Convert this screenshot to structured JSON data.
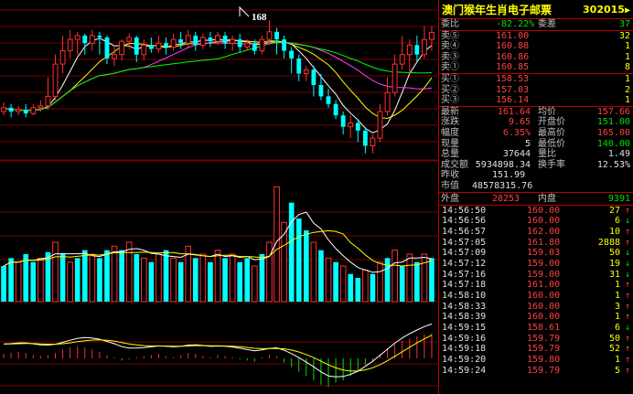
{
  "stock": {
    "name": "澳门猴年生肖电子邮票",
    "code": "302015"
  },
  "annotation": "168",
  "ratio": {
    "label": "委比",
    "value": "-82.22%",
    "diff_label": "委差",
    "diff_value": "37"
  },
  "sells": [
    {
      "label": "卖⑤",
      "price": "161.00",
      "vol": "32"
    },
    {
      "label": "卖④",
      "price": "160.88",
      "vol": "1"
    },
    {
      "label": "卖③",
      "price": "160.86",
      "vol": "1"
    },
    {
      "label": "卖①",
      "price": "160.85",
      "vol": "8"
    }
  ],
  "buys": [
    {
      "label": "买①",
      "price": "158.53",
      "vol": "1"
    },
    {
      "label": "买②",
      "price": "157.03",
      "vol": "2"
    },
    {
      "label": "买③",
      "price": "156.14",
      "vol": "1"
    }
  ],
  "stats": [
    {
      "l1": "最新",
      "v1": "161.64",
      "c1": "red",
      "l2": "均价",
      "v2": "157.66",
      "c2": "red"
    },
    {
      "l1": "涨跌",
      "v1": "9.65",
      "c1": "red",
      "l2": "开盘价",
      "v2": "151.00",
      "c2": "grn"
    },
    {
      "l1": "幅度",
      "v1": "6.35%",
      "c1": "red",
      "l2": "最高价",
      "v2": "165.00",
      "c2": "red"
    },
    {
      "l1": "现量",
      "v1": "5",
      "c1": "wht",
      "l2": "最低价",
      "v2": "140.00",
      "c2": "grn"
    },
    {
      "l1": "总量",
      "v1": "37644",
      "c1": "wht",
      "l2": "量比",
      "v2": "1.49",
      "c2": "wht"
    },
    {
      "l1": "成交额",
      "v1": "5934898.34",
      "c1": "wht",
      "l2": "换手率",
      "v2": "12.53%",
      "c2": "wht"
    }
  ],
  "prev_close": {
    "label": "昨收",
    "value": "151.99"
  },
  "market_cap": {
    "label": "市值",
    "value": "48578315.76"
  },
  "outer_inner": {
    "outer_label": "外盘",
    "outer_value": "28253",
    "inner_label": "内盘",
    "inner_value": "9391"
  },
  "ticks": [
    {
      "time": "14:56:50",
      "price": "160.00",
      "vol": "27",
      "dir": "up"
    },
    {
      "time": "14:56:56",
      "price": "160.00",
      "vol": "6",
      "dir": "down"
    },
    {
      "time": "14:56:57",
      "price": "162.00",
      "vol": "10",
      "dir": "up"
    },
    {
      "time": "14:57:05",
      "price": "161.80",
      "vol": "2888",
      "dir": "up"
    },
    {
      "time": "14:57:09",
      "price": "159.03",
      "vol": "50",
      "dir": "down"
    },
    {
      "time": "14:57:12",
      "price": "159.00",
      "vol": "19",
      "dir": "down"
    },
    {
      "time": "14:57:16",
      "price": "159.00",
      "vol": "31",
      "dir": "down"
    },
    {
      "time": "14:57:18",
      "price": "161.00",
      "vol": "1",
      "dir": "up"
    },
    {
      "time": "14:58:10",
      "price": "160.00",
      "vol": "1",
      "dir": "up"
    },
    {
      "time": "14:58:33",
      "price": "160.00",
      "vol": "3",
      "dir": "up"
    },
    {
      "time": "14:58:39",
      "price": "160.00",
      "vol": "1",
      "dir": "up"
    },
    {
      "time": "14:59:15",
      "price": "158.61",
      "vol": "6",
      "dir": "down"
    },
    {
      "time": "14:59:16",
      "price": "159.79",
      "vol": "50",
      "dir": "up"
    },
    {
      "time": "14:59:18",
      "price": "159.79",
      "vol": "52",
      "dir": "up"
    },
    {
      "time": "14:59:20",
      "price": "159.80",
      "vol": "1",
      "dir": "up"
    },
    {
      "time": "14:59:24",
      "price": "159.79",
      "vol": "5",
      "dir": "up"
    }
  ],
  "colors": {
    "up": "#ff3030",
    "down": "#00ffff",
    "ma1": "#ffffff",
    "ma2": "#ffff00",
    "ma3": "#ff40ff",
    "ma4": "#00ff00",
    "grid": "#a00000"
  },
  "chart_data": {
    "type": "candlestick",
    "candles": [
      {
        "o": 120,
        "c": 122,
        "h": 125,
        "l": 118
      },
      {
        "o": 122,
        "c": 120,
        "h": 124,
        "l": 117
      },
      {
        "o": 120,
        "c": 121,
        "h": 123,
        "l": 118
      },
      {
        "o": 121,
        "c": 119,
        "h": 124,
        "l": 117
      },
      {
        "o": 119,
        "c": 122,
        "h": 124,
        "l": 118
      },
      {
        "o": 122,
        "c": 123,
        "h": 126,
        "l": 120
      },
      {
        "o": 123,
        "c": 128,
        "h": 138,
        "l": 121
      },
      {
        "o": 128,
        "c": 145,
        "h": 150,
        "l": 126
      },
      {
        "o": 145,
        "c": 152,
        "h": 160,
        "l": 140
      },
      {
        "o": 152,
        "c": 158,
        "h": 163,
        "l": 148
      },
      {
        "o": 158,
        "c": 160,
        "h": 162,
        "l": 150
      },
      {
        "o": 160,
        "c": 156,
        "h": 161,
        "l": 150
      },
      {
        "o": 156,
        "c": 160,
        "h": 163,
        "l": 152
      },
      {
        "o": 160,
        "c": 159,
        "h": 162,
        "l": 150
      },
      {
        "o": 159,
        "c": 148,
        "h": 160,
        "l": 145
      },
      {
        "o": 148,
        "c": 150,
        "h": 154,
        "l": 144
      },
      {
        "o": 150,
        "c": 157,
        "h": 158,
        "l": 147
      },
      {
        "o": 157,
        "c": 159,
        "h": 161,
        "l": 153
      },
      {
        "o": 159,
        "c": 150,
        "h": 160,
        "l": 146
      },
      {
        "o": 150,
        "c": 155,
        "h": 158,
        "l": 147
      },
      {
        "o": 155,
        "c": 153,
        "h": 159,
        "l": 151
      },
      {
        "o": 153,
        "c": 156,
        "h": 160,
        "l": 151
      },
      {
        "o": 156,
        "c": 154,
        "h": 159,
        "l": 150
      },
      {
        "o": 154,
        "c": 158,
        "h": 161,
        "l": 152
      },
      {
        "o": 158,
        "c": 156,
        "h": 162,
        "l": 153
      },
      {
        "o": 156,
        "c": 160,
        "h": 163,
        "l": 154
      },
      {
        "o": 160,
        "c": 155,
        "h": 162,
        "l": 152
      },
      {
        "o": 155,
        "c": 159,
        "h": 161,
        "l": 153
      },
      {
        "o": 159,
        "c": 157,
        "h": 162,
        "l": 154
      },
      {
        "o": 157,
        "c": 160,
        "h": 162,
        "l": 155
      },
      {
        "o": 160,
        "c": 156,
        "h": 162,
        "l": 153
      },
      {
        "o": 156,
        "c": 158,
        "h": 160,
        "l": 152
      },
      {
        "o": 158,
        "c": 154,
        "h": 161,
        "l": 151
      },
      {
        "o": 154,
        "c": 156,
        "h": 158,
        "l": 152
      },
      {
        "o": 156,
        "c": 152,
        "h": 158,
        "l": 150
      },
      {
        "o": 152,
        "c": 158,
        "h": 160,
        "l": 150
      },
      {
        "o": 158,
        "c": 162,
        "h": 168,
        "l": 155
      },
      {
        "o": 162,
        "c": 158,
        "h": 164,
        "l": 150
      },
      {
        "o": 158,
        "c": 152,
        "h": 160,
        "l": 148
      },
      {
        "o": 152,
        "c": 148,
        "h": 154,
        "l": 140
      },
      {
        "o": 148,
        "c": 140,
        "h": 150,
        "l": 136
      },
      {
        "o": 140,
        "c": 142,
        "h": 144,
        "l": 136
      },
      {
        "o": 142,
        "c": 134,
        "h": 144,
        "l": 128
      },
      {
        "o": 134,
        "c": 128,
        "h": 140,
        "l": 126
      },
      {
        "o": 128,
        "c": 124,
        "h": 132,
        "l": 122
      },
      {
        "o": 124,
        "c": 118,
        "h": 126,
        "l": 116
      },
      {
        "o": 118,
        "c": 112,
        "h": 120,
        "l": 108
      },
      {
        "o": 112,
        "c": 114,
        "h": 118,
        "l": 106
      },
      {
        "o": 114,
        "c": 110,
        "h": 116,
        "l": 104
      },
      {
        "o": 110,
        "c": 102,
        "h": 112,
        "l": 98
      },
      {
        "o": 102,
        "c": 106,
        "h": 108,
        "l": 98
      },
      {
        "o": 106,
        "c": 120,
        "h": 124,
        "l": 104
      },
      {
        "o": 120,
        "c": 130,
        "h": 138,
        "l": 118
      },
      {
        "o": 130,
        "c": 145,
        "h": 150,
        "l": 128
      },
      {
        "o": 145,
        "c": 150,
        "h": 160,
        "l": 142
      },
      {
        "o": 150,
        "c": 155,
        "h": 158,
        "l": 140
      },
      {
        "o": 155,
        "c": 150,
        "h": 160,
        "l": 146
      },
      {
        "o": 150,
        "c": 158,
        "h": 165,
        "l": 148
      },
      {
        "o": 158,
        "c": 161.64,
        "h": 165,
        "l": 152
      }
    ],
    "volumes": [
      {
        "v": 18,
        "up": false
      },
      {
        "v": 22,
        "up": false
      },
      {
        "v": 20,
        "up": true
      },
      {
        "v": 24,
        "up": false
      },
      {
        "v": 20,
        "up": false
      },
      {
        "v": 22,
        "up": true
      },
      {
        "v": 25,
        "up": false
      },
      {
        "v": 30,
        "up": true
      },
      {
        "v": 24,
        "up": false
      },
      {
        "v": 20,
        "up": true
      },
      {
        "v": 22,
        "up": false
      },
      {
        "v": 26,
        "up": false
      },
      {
        "v": 24,
        "up": true
      },
      {
        "v": 22,
        "up": false
      },
      {
        "v": 26,
        "up": false
      },
      {
        "v": 28,
        "up": true
      },
      {
        "v": 26,
        "up": false
      },
      {
        "v": 30,
        "up": true
      },
      {
        "v": 24,
        "up": false
      },
      {
        "v": 22,
        "up": true
      },
      {
        "v": 20,
        "up": false
      },
      {
        "v": 24,
        "up": true
      },
      {
        "v": 26,
        "up": false
      },
      {
        "v": 22,
        "up": true
      },
      {
        "v": 20,
        "up": false
      },
      {
        "v": 28,
        "up": true
      },
      {
        "v": 22,
        "up": false
      },
      {
        "v": 24,
        "up": true
      },
      {
        "v": 20,
        "up": false
      },
      {
        "v": 26,
        "up": true
      },
      {
        "v": 22,
        "up": false
      },
      {
        "v": 24,
        "up": true
      },
      {
        "v": 20,
        "up": false
      },
      {
        "v": 22,
        "up": false
      },
      {
        "v": 18,
        "up": true
      },
      {
        "v": 24,
        "up": false
      },
      {
        "v": 30,
        "up": true
      },
      {
        "v": 58,
        "up": true
      },
      {
        "v": 40,
        "up": true
      },
      {
        "v": 50,
        "up": false
      },
      {
        "v": 42,
        "up": false
      },
      {
        "v": 36,
        "up": false
      },
      {
        "v": 30,
        "up": true
      },
      {
        "v": 26,
        "up": false
      },
      {
        "v": 22,
        "up": true
      },
      {
        "v": 20,
        "up": false
      },
      {
        "v": 18,
        "up": true
      },
      {
        "v": 14,
        "up": false
      },
      {
        "v": 12,
        "up": false
      },
      {
        "v": 16,
        "up": true
      },
      {
        "v": 14,
        "up": false
      },
      {
        "v": 20,
        "up": true
      },
      {
        "v": 22,
        "up": false
      },
      {
        "v": 26,
        "up": true
      },
      {
        "v": 18,
        "up": false
      },
      {
        "v": 24,
        "up": true
      },
      {
        "v": 20,
        "up": false
      },
      {
        "v": 24,
        "up": true
      },
      {
        "v": 22,
        "up": false
      }
    ],
    "macd": [
      0.4,
      0.5,
      0.6,
      0.5,
      0.3,
      0.2,
      0.3,
      0.5,
      0.8,
      1.0,
      1.1,
      1.0,
      0.8,
      0.6,
      0.3,
      0.1,
      -0.2,
      -0.1,
      0.1,
      0.2,
      0.3,
      0.4,
      0.2,
      0.1,
      0.3,
      0.5,
      0.4,
      0.2,
      0.1,
      0.3,
      0.2,
      0.1,
      -0.1,
      -0.2,
      -0.3,
      0.1,
      0.3,
      0.2,
      -0.4,
      -0.8,
      -1.2,
      -1.6,
      -2.0,
      -2.4,
      -2.6,
      -2.2,
      -2.0,
      -1.6,
      -1.2,
      -0.6,
      -0.2,
      0.4,
      0.9,
      1.3,
      1.6,
      1.8,
      2.0,
      2.2,
      2.3
    ]
  }
}
